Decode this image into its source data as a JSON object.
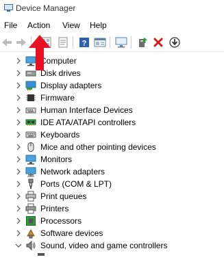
{
  "window": {
    "title": "Device Manager"
  },
  "menu": {
    "items": [
      "File",
      "Action",
      "View",
      "Help"
    ]
  },
  "toolbar": {
    "buttons": [
      "back-icon",
      "forward-icon",
      "properties-grid-icon",
      "properties-icon",
      "help-icon",
      "view-icon",
      "monitor-icon",
      "update-driver-icon",
      "uninstall-icon",
      "download-icon"
    ]
  },
  "tree": {
    "categories": [
      {
        "label": "Computer",
        "icon": "computer-icon"
      },
      {
        "label": "Disk drives",
        "icon": "disk-drive-icon"
      },
      {
        "label": "Display adapters",
        "icon": "display-adapter-icon"
      },
      {
        "label": "Firmware",
        "icon": "firmware-icon"
      },
      {
        "label": "Human Interface Devices",
        "icon": "hid-icon"
      },
      {
        "label": "IDE ATA/ATAPI controllers",
        "icon": "ide-controller-icon"
      },
      {
        "label": "Keyboards",
        "icon": "keyboard-icon"
      },
      {
        "label": "Mice and other pointing devices",
        "icon": "mouse-icon"
      },
      {
        "label": "Monitors",
        "icon": "monitor-icon"
      },
      {
        "label": "Network adapters",
        "icon": "network-adapter-icon"
      },
      {
        "label": "Ports (COM & LPT)",
        "icon": "port-icon"
      },
      {
        "label": "Print queues",
        "icon": "print-queue-icon"
      },
      {
        "label": "Printers",
        "icon": "printer-icon"
      },
      {
        "label": "Processors",
        "icon": "processor-icon"
      },
      {
        "label": "Software devices",
        "icon": "software-device-icon"
      },
      {
        "label": "Sound, video and game controllers",
        "icon": "sound-icon",
        "expanded": true
      }
    ]
  },
  "annotation": {
    "arrow_color": "#e81123"
  }
}
